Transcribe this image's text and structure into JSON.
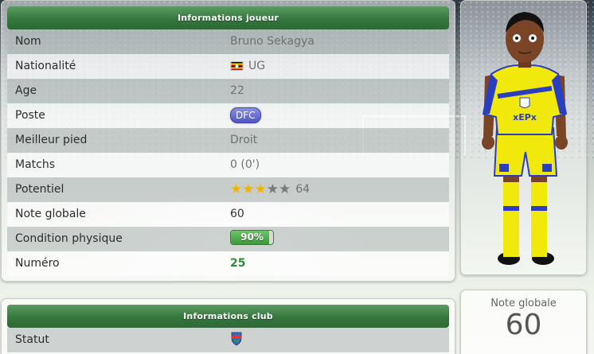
{
  "player_info": {
    "header": "Informations joueur",
    "rows": [
      {
        "label": "Nom",
        "value": "Bruno Sekagya"
      },
      {
        "label": "Nationalité",
        "value": "UG"
      },
      {
        "label": "Age",
        "value": "22"
      },
      {
        "label": "Poste",
        "value": "DFC"
      },
      {
        "label": "Meilleur pied",
        "value": "Droit"
      },
      {
        "label": "Matchs",
        "value": "0 (0')"
      },
      {
        "label": "Potentiel",
        "value": "64",
        "stars_filled": 3,
        "stars_total": 5
      },
      {
        "label": "Note globale",
        "value": "60"
      },
      {
        "label": "Condition physique",
        "value": "90%",
        "fill_percent": 90
      },
      {
        "label": "Numéro",
        "value": "25"
      }
    ]
  },
  "club_info": {
    "header": "Informations club",
    "rows": [
      {
        "label": "Statut",
        "value_icon": "club-crest-icon"
      }
    ]
  },
  "overall": {
    "label": "Note globale",
    "value": "60"
  },
  "colors": {
    "header_green": "#35773e",
    "position_badge": "#4e56c2",
    "star": "#f2b400",
    "condition_green": "#3b9a3a",
    "number_green": "#2f8a3a",
    "kit_yellow": "#f2e90c",
    "kit_blue": "#2a3fbf"
  }
}
